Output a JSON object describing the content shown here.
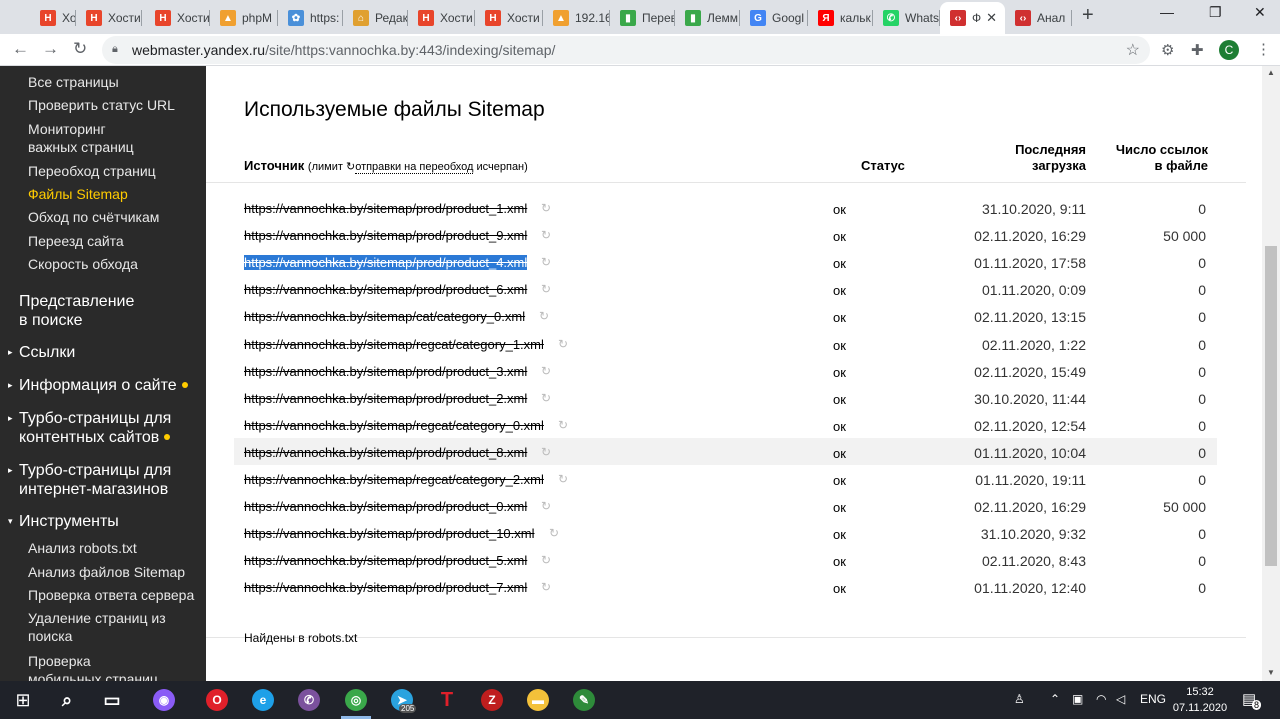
{
  "browser": {
    "tabs": [
      {
        "label": "Хости",
        "icon": "hostia-icon",
        "color": "#e8452b",
        "glyph": "H"
      },
      {
        "label": "Хости",
        "icon": "hostia-icon",
        "color": "#e8452b",
        "glyph": "H"
      },
      {
        "label": "Хости",
        "icon": "hostia-icon",
        "color": "#e8452b",
        "glyph": "H"
      },
      {
        "label": "phpM",
        "icon": "phpmyadmin-icon",
        "color": "#f0a030",
        "glyph": "▲"
      },
      {
        "label": "https:",
        "icon": "gear-icon",
        "color": "#4a90d9",
        "glyph": "✿"
      },
      {
        "label": "Редак",
        "icon": "home-icon",
        "color": "#e0a030",
        "glyph": "⌂"
      },
      {
        "label": "Хости",
        "icon": "hostia-icon",
        "color": "#e8452b",
        "glyph": "H"
      },
      {
        "label": "Хости",
        "icon": "hostia-icon",
        "color": "#e8452b",
        "glyph": "H"
      },
      {
        "label": "192.16",
        "icon": "phpmyadmin-icon",
        "color": "#f0a030",
        "glyph": "▲"
      },
      {
        "label": "Перев",
        "icon": "chart-icon",
        "color": "#3aa84a",
        "glyph": "▮"
      },
      {
        "label": "Лемм",
        "icon": "chart-icon",
        "color": "#3aa84a",
        "glyph": "▮"
      },
      {
        "label": "Googl",
        "icon": "translate-icon",
        "color": "#4285f4",
        "glyph": "G"
      },
      {
        "label": "кальк",
        "icon": "yandex-icon",
        "color": "#ff0000",
        "glyph": "Я"
      },
      {
        "label": "Whats",
        "icon": "whatsapp-icon",
        "color": "#25d366",
        "glyph": "✆"
      },
      {
        "label": "Ф",
        "icon": "code-icon",
        "color": "#d03030",
        "glyph": "‹›",
        "active": true
      },
      {
        "label": "Анал",
        "icon": "code-icon",
        "color": "#d03030",
        "glyph": "‹›"
      }
    ],
    "url_host": "webmaster.yandex.ru",
    "url_path": "/site/https:vannochka.by:443/indexing/sitemap/",
    "avatar_letter": "C"
  },
  "sidebar": {
    "items_top": [
      {
        "label": "Все страницы"
      },
      {
        "label": "Проверить статус URL"
      },
      {
        "label": "Мониторинг\nважных страниц"
      },
      {
        "label": "Переобход страниц"
      },
      {
        "label": "Файлы Sitemap",
        "active": true
      },
      {
        "label": "Обход по счётчикам"
      },
      {
        "label": "Переезд сайта"
      },
      {
        "label": "Скорость обхода"
      }
    ],
    "sections": [
      {
        "label": "Представление\nв поиске",
        "arrow": "",
        "dot": false
      },
      {
        "label": "Ссылки",
        "arrow": "▸",
        "dot": false
      },
      {
        "label": "Информация о сайте",
        "arrow": "▸",
        "dot": true
      },
      {
        "label": "Турбо-страницы для\nконтентных сайтов",
        "arrow": "▸",
        "dot": true
      },
      {
        "label": "Турбо-страницы для\nинтернет-магазинов",
        "arrow": "▸",
        "dot": false
      },
      {
        "label": "Инструменты",
        "arrow": "▾",
        "dot": false
      }
    ],
    "tools": [
      {
        "label": "Анализ robots.txt"
      },
      {
        "label": "Анализ файлов Sitemap"
      },
      {
        "label": "Проверка ответа сервера"
      },
      {
        "label": "Удаление страниц из\nпоиска"
      },
      {
        "label": "Проверка\nмобильных страниц"
      }
    ]
  },
  "main": {
    "title": "Используемые файлы Sitemap",
    "col_source": "Источник",
    "limit_prefix": "(лимит",
    "limit_link": "отправки на переобход",
    "limit_suffix": "исчерпан)",
    "col_status": "Статус",
    "col_last": "Последняя\nзагрузка",
    "col_links": "Число ссылок\nв файле",
    "rows": [
      {
        "url": "https://vannochka.by/sitemap/prod/product_1.xml",
        "status": "ок",
        "date": "31.10.2020, 9:11",
        "count": "0"
      },
      {
        "url": "https://vannochka.by/sitemap/prod/product_9.xml",
        "status": "ок",
        "date": "02.11.2020, 16:29",
        "count": "50 000"
      },
      {
        "url": "https://vannochka.by/sitemap/prod/product_4.xml",
        "status": "ок",
        "date": "01.11.2020, 17:58",
        "count": "0",
        "selected": true
      },
      {
        "url": "https://vannochka.by/sitemap/prod/product_6.xml",
        "status": "ок",
        "date": "01.11.2020, 0:09",
        "count": "0"
      },
      {
        "url": "https://vannochka.by/sitemap/cat/category_0.xml",
        "status": "ок",
        "date": "02.11.2020, 13:15",
        "count": "0"
      },
      {
        "url": "https://vannochka.by/sitemap/regcat/category_1.xml",
        "status": "ок",
        "date": "02.11.2020, 1:22",
        "count": "0"
      },
      {
        "url": "https://vannochka.by/sitemap/prod/product_3.xml",
        "status": "ок",
        "date": "02.11.2020, 15:49",
        "count": "0"
      },
      {
        "url": "https://vannochka.by/sitemap/prod/product_2.xml",
        "status": "ок",
        "date": "30.10.2020, 11:44",
        "count": "0"
      },
      {
        "url": "https://vannochka.by/sitemap/regcat/category_0.xml",
        "status": "ок",
        "date": "02.11.2020, 12:54",
        "count": "0"
      },
      {
        "url": "https://vannochka.by/sitemap/prod/product_8.xml",
        "status": "ок",
        "date": "01.11.2020, 10:04",
        "count": "0",
        "hover": true
      },
      {
        "url": "https://vannochka.by/sitemap/regcat/category_2.xml",
        "status": "ок",
        "date": "01.11.2020, 19:11",
        "count": "0"
      },
      {
        "url": "https://vannochka.by/sitemap/prod/product_0.xml",
        "status": "ок",
        "date": "02.11.2020, 16:29",
        "count": "50 000"
      },
      {
        "url": "https://vannochka.by/sitemap/prod/product_10.xml",
        "status": "ок",
        "date": "31.10.2020, 9:32",
        "count": "0"
      },
      {
        "url": "https://vannochka.by/sitemap/prod/product_5.xml",
        "status": "ок",
        "date": "02.11.2020, 8:43",
        "count": "0"
      },
      {
        "url": "https://vannochka.by/sitemap/prod/product_7.xml",
        "status": "ок",
        "date": "01.11.2020, 12:40",
        "count": "0"
      }
    ],
    "found_robots": "Найдены в robots.txt"
  },
  "taskbar": {
    "apps": [
      {
        "name": "search-icon",
        "glyph": "⌕",
        "color": ""
      },
      {
        "name": "task-view-icon",
        "glyph": "▭",
        "color": ""
      },
      {
        "name": "alice-icon",
        "glyph": "◉",
        "color": "#8a5cf6"
      },
      {
        "name": "opera-icon",
        "glyph": "O",
        "color": "#e0202a"
      },
      {
        "name": "ie-icon",
        "glyph": "e",
        "color": "#1ea0e8"
      },
      {
        "name": "viber-icon",
        "glyph": "✆",
        "color": "#7b519d"
      },
      {
        "name": "chrome-icon",
        "glyph": "◎",
        "color": "#3aa84a"
      },
      {
        "name": "telegram-icon",
        "glyph": "➤",
        "color": "#2aa3df"
      },
      {
        "name": "t-icon",
        "glyph": "T",
        "color": ""
      },
      {
        "name": "filezilla-icon",
        "glyph": "Z",
        "color": "#bf1e1e"
      },
      {
        "name": "folder-icon",
        "glyph": "▬",
        "color": "#f3c13a"
      },
      {
        "name": "notepad-icon",
        "glyph": "✎",
        "color": "#2e8b3a"
      }
    ],
    "telegram_badge": "205",
    "lang": "ENG",
    "time": "15:32",
    "date": "07.11.2020",
    "notif_count": "8"
  }
}
